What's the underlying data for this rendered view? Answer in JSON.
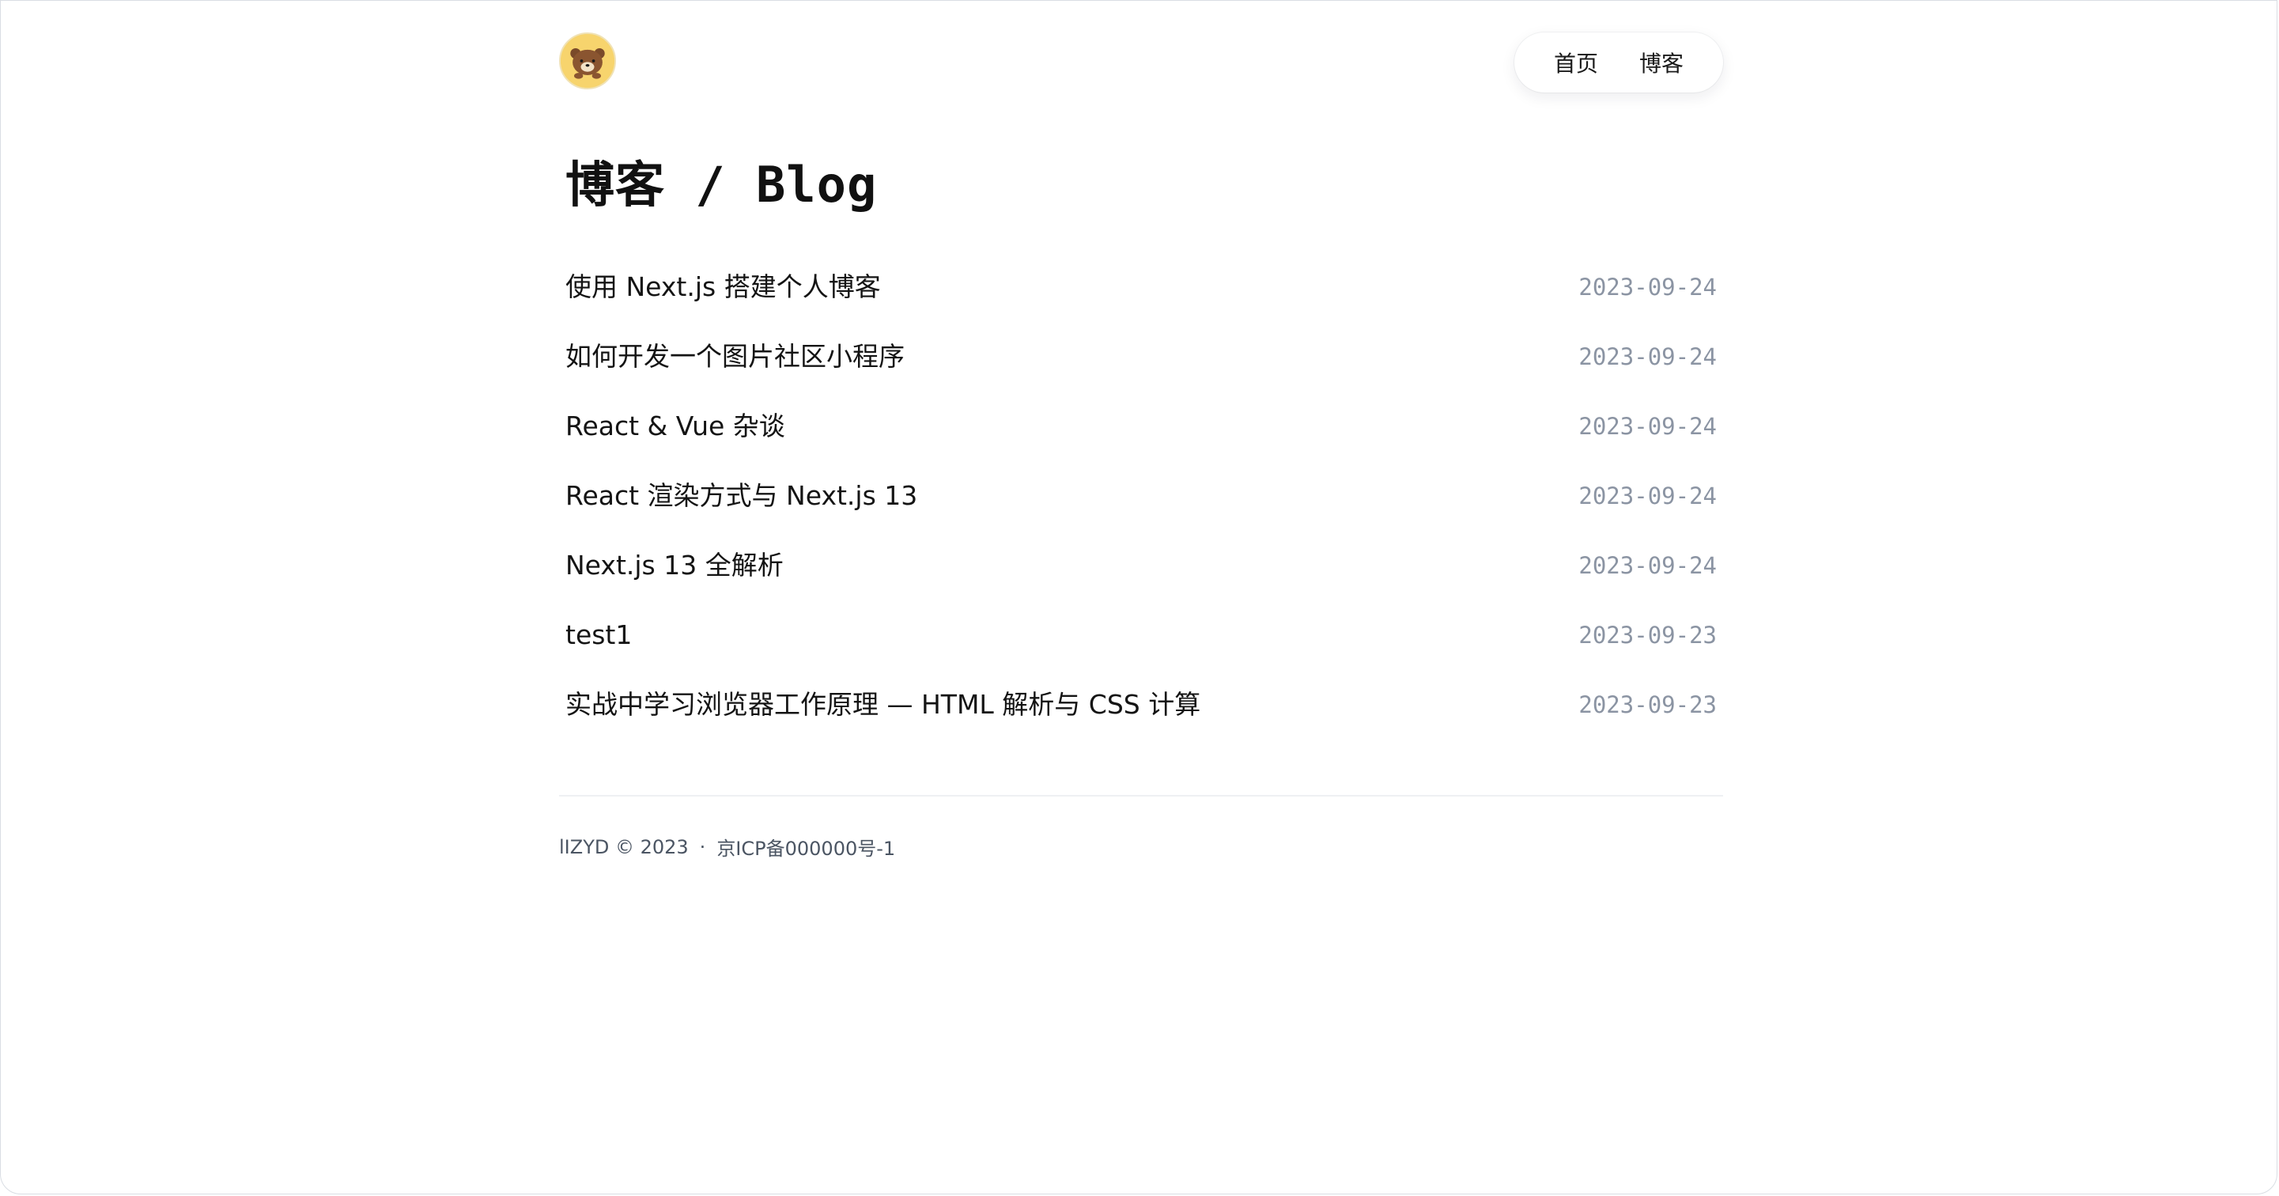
{
  "header": {
    "avatar_icon": "bear-avatar-icon",
    "nav": [
      {
        "label": "首页"
      },
      {
        "label": "博客"
      }
    ]
  },
  "page": {
    "title": "博客 / Blog"
  },
  "posts": [
    {
      "title": "使用 Next.js 搭建个人博客",
      "date": "2023-09-24"
    },
    {
      "title": "如何开发一个图片社区小程序",
      "date": "2023-09-24"
    },
    {
      "title": "React & Vue 杂谈",
      "date": "2023-09-24"
    },
    {
      "title": "React 渲染方式与 Next.js 13",
      "date": "2023-09-24"
    },
    {
      "title": "Next.js 13 全解析",
      "date": "2023-09-24"
    },
    {
      "title": "test1",
      "date": "2023-09-23"
    },
    {
      "title": "实战中学习浏览器工作原理 — HTML 解析与 CSS 计算",
      "date": "2023-09-23"
    }
  ],
  "footer": {
    "copyright": "lIZYD © 2023",
    "separator": "·",
    "icp": "京ICP备000000号-1"
  },
  "colors": {
    "date_text": "#8b94a3",
    "footer_text": "#4b5563",
    "avatar_bg": "#f6d36a"
  }
}
